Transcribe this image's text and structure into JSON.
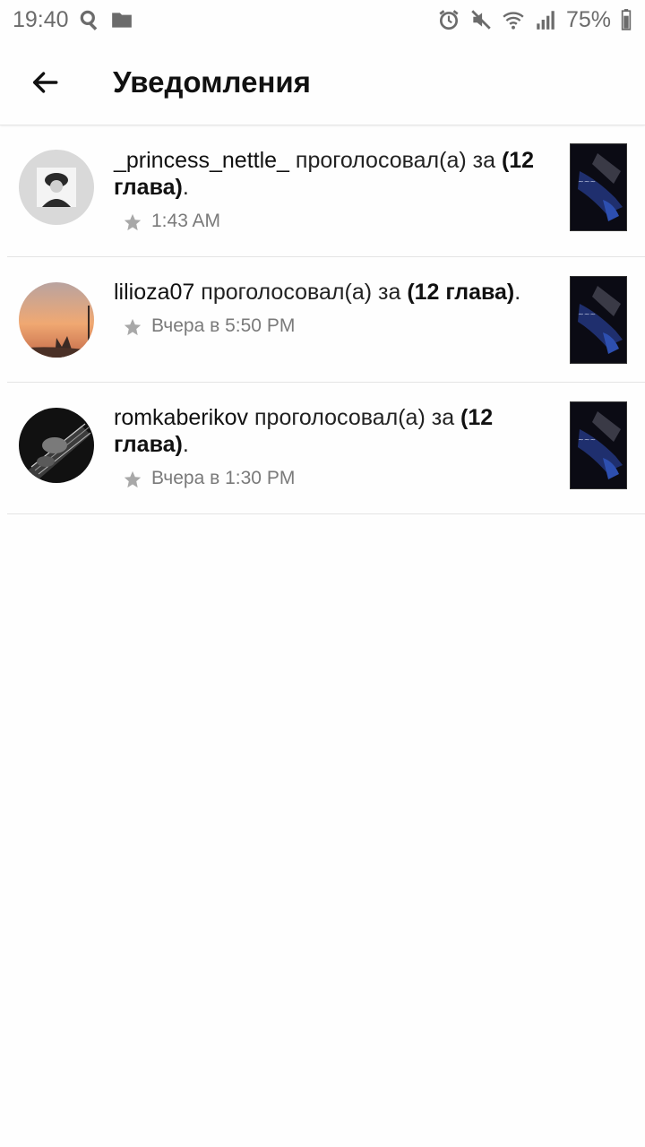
{
  "status_bar": {
    "time": "19:40",
    "battery": "75%",
    "left_icons": [
      "search-icon",
      "folder-icon"
    ],
    "right_icons": [
      "alarm-icon",
      "mute-icon",
      "wifi-icon",
      "signal-icon",
      "battery-icon"
    ]
  },
  "header": {
    "back_icon": "arrow-left-icon",
    "title": "Уведомления"
  },
  "notifications": [
    {
      "username": "_princess_nettle_",
      "action": " проголосовал(а) за ",
      "chapter": "(12 глава)",
      "suffix": ".",
      "time": "1:43 AM",
      "avatar_colors": [
        "#d9d9d9",
        "#2a2a2a"
      ]
    },
    {
      "username": "lilioza07",
      "action": " проголосовал(а) за ",
      "chapter": "(12 глава)",
      "suffix": ".",
      "time": "Вчера в 5:50 PM",
      "avatar_colors": [
        "#f0a872",
        "#c46b4a"
      ]
    },
    {
      "username": "romkaberikov",
      "action": " проголосовал(а) за ",
      "chapter": "(12 глава)",
      "suffix": ".",
      "time": "Вчера в 1:30 PM",
      "avatar_colors": [
        "#111111",
        "#9a9a9a"
      ]
    }
  ],
  "colors": {
    "text_primary": "#111111",
    "text_secondary": "#7a7a7a",
    "divider": "#e4e4e4",
    "star": "#a8a8a8"
  }
}
